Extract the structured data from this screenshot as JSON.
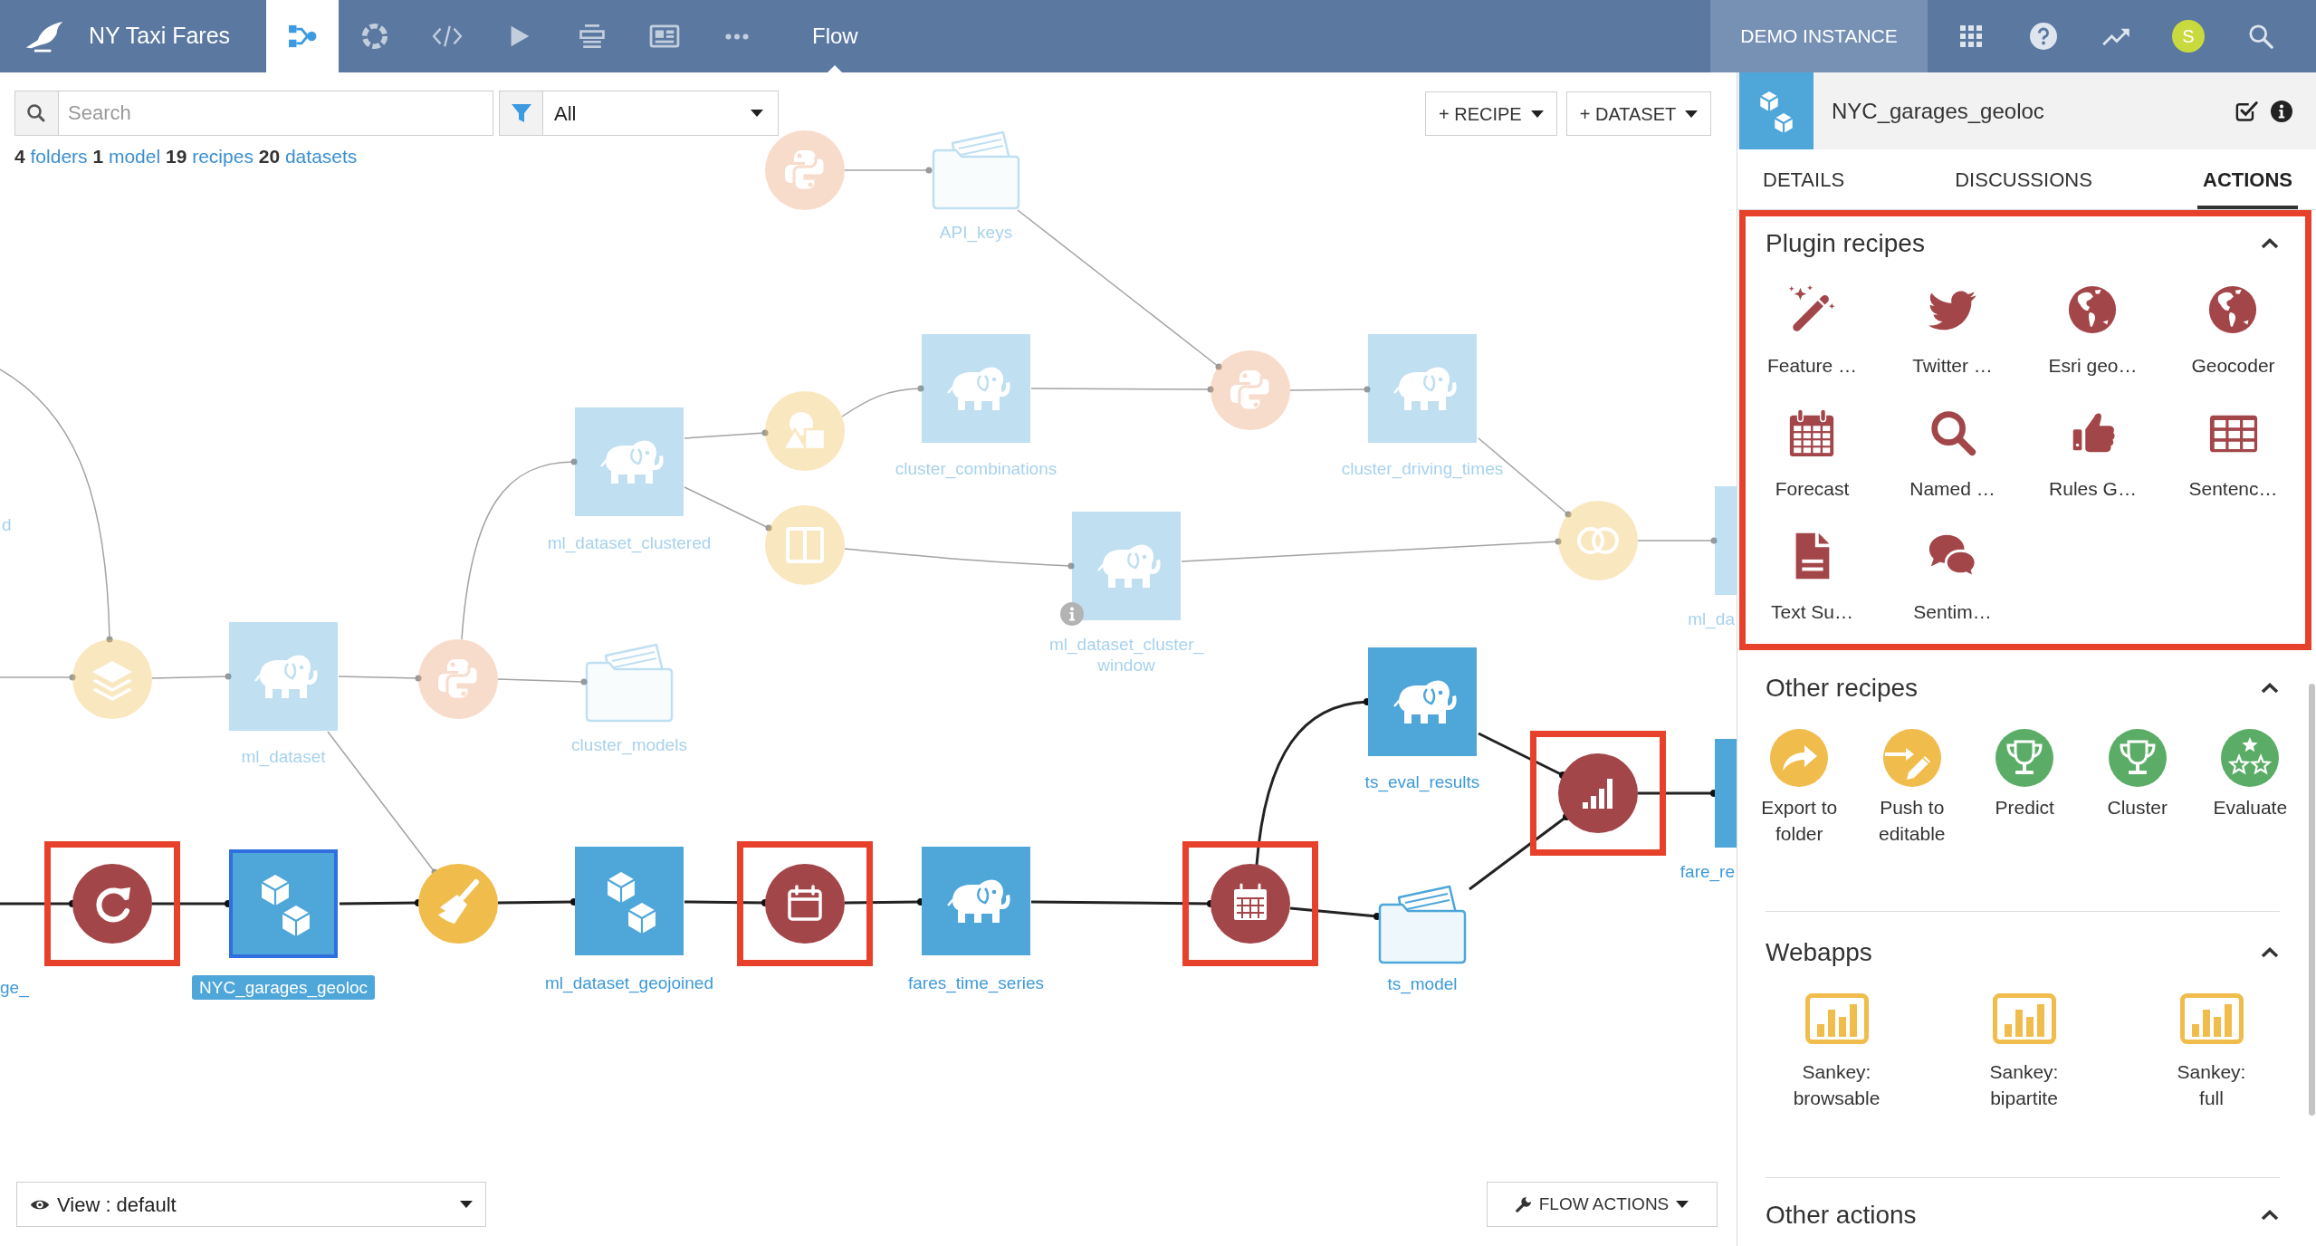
{
  "topbar": {
    "project_title": "NY Taxi Fares",
    "nav": [
      {
        "selected": true
      },
      {
        "selected": false
      },
      {
        "selected": false
      },
      {
        "selected": false
      },
      {
        "selected": false
      },
      {
        "selected": false
      },
      {
        "selected": false
      }
    ],
    "page_title": "Flow",
    "instance_label": "DEMO INSTANCE",
    "avatar": "S"
  },
  "toolbar": {
    "search": {
      "placeholder": "Search"
    },
    "filter": {
      "value": "All"
    },
    "counts": [
      {
        "count": "4",
        "label": "folders"
      },
      {
        "count": "1",
        "label": "model"
      },
      {
        "count": "19",
        "label": "recipes"
      },
      {
        "count": "20",
        "label": "datasets"
      }
    ],
    "buttons": [
      "+ RECIPE",
      "+ DATASET"
    ]
  },
  "flow": {
    "nodes": [
      {
        "kind": "recipe",
        "dimmed": true,
        "selected": false,
        "highlighted": false,
        "info_badge": false
      },
      {
        "kind": "folder",
        "label": "API_keys",
        "dimmed": true,
        "selected": false,
        "highlighted": false,
        "info_badge": false
      },
      {
        "kind": "recipe",
        "dimmed": true,
        "selected": false,
        "highlighted": false,
        "info_badge": false
      },
      {
        "kind": "dataset",
        "label": "cluster_combinations",
        "dimmed": true,
        "selected": false,
        "highlighted": false,
        "info_badge": false
      },
      {
        "kind": "dataset",
        "label": "cluster_driving_times",
        "dimmed": true,
        "selected": false,
        "highlighted": false,
        "info_badge": false
      },
      {
        "kind": "recipe",
        "dimmed": true,
        "selected": false,
        "highlighted": false,
        "info_badge": false
      },
      {
        "kind": "dataset",
        "label": "ml_dataset_clustered",
        "dimmed": true,
        "selected": false,
        "highlighted": false,
        "info_badge": false
      },
      {
        "kind": "recipe",
        "dimmed": true,
        "selected": false,
        "highlighted": false,
        "info_badge": false
      },
      {
        "kind": "dataset",
        "label": "ml_dataset_cluster_window",
        "dimmed": true,
        "selected": false,
        "highlighted": false,
        "info_badge": true
      },
      {
        "kind": "recipe",
        "dimmed": true,
        "selected": false,
        "highlighted": false,
        "info_badge": false
      },
      {
        "kind": "dataset",
        "label": "ml_da",
        "dimmed": true,
        "selected": false,
        "highlighted": false,
        "info_badge": false
      },
      {
        "kind": "dataset",
        "label": "d",
        "dimmed": true,
        "selected": false,
        "highlighted": false,
        "info_badge": false
      },
      {
        "kind": "recipe",
        "dimmed": true,
        "selected": false,
        "highlighted": false,
        "info_badge": false
      },
      {
        "kind": "dataset",
        "label": "ml_dataset",
        "dimmed": true,
        "selected": false,
        "highlighted": false,
        "info_badge": false
      },
      {
        "kind": "recipe",
        "dimmed": true,
        "selected": false,
        "highlighted": false,
        "info_badge": false
      },
      {
        "kind": "folder",
        "label": "cluster_models",
        "dimmed": true,
        "selected": false,
        "highlighted": false,
        "info_badge": false
      },
      {
        "kind": "dataset",
        "label": "ge_",
        "dimmed": false,
        "selected": false,
        "highlighted": false,
        "info_badge": false
      },
      {
        "kind": "recipe",
        "dimmed": false,
        "selected": false,
        "highlighted": true,
        "info_badge": false
      },
      {
        "kind": "dataset",
        "label": "NYC_garages_geoloc",
        "dimmed": false,
        "selected": true,
        "highlighted": false,
        "info_badge": false
      },
      {
        "kind": "recipe",
        "dimmed": false,
        "selected": false,
        "highlighted": false,
        "info_badge": false
      },
      {
        "kind": "dataset",
        "label": "ml_dataset_geojoined",
        "dimmed": false,
        "selected": false,
        "highlighted": false,
        "info_badge": false
      },
      {
        "kind": "recipe",
        "dimmed": false,
        "selected": false,
        "highlighted": true,
        "info_badge": false
      },
      {
        "kind": "dataset",
        "label": "fares_time_series",
        "dimmed": false,
        "selected": false,
        "highlighted": false,
        "info_badge": false
      },
      {
        "kind": "recipe",
        "dimmed": false,
        "selected": false,
        "highlighted": true,
        "info_badge": false
      },
      {
        "kind": "dataset",
        "label": "ts_eval_results",
        "dimmed": false,
        "selected": false,
        "highlighted": false,
        "info_badge": false
      },
      {
        "kind": "folder",
        "label": "ts_model",
        "dimmed": false,
        "selected": false,
        "highlighted": false,
        "info_badge": false
      },
      {
        "kind": "recipe",
        "dimmed": false,
        "selected": false,
        "highlighted": true,
        "info_badge": false
      },
      {
        "kind": "dataset",
        "label": "fare_re",
        "dimmed": false,
        "selected": false,
        "highlighted": false,
        "info_badge": false
      }
    ]
  },
  "bottom_bar": {
    "view": "View : default",
    "flow_actions": "FLOW ACTIONS"
  },
  "panel": {
    "title": "NYC_garages_geoloc",
    "tabs": [
      {
        "label": "DETAILS",
        "selected": false
      },
      {
        "label": "DISCUSSIONS",
        "selected": false
      },
      {
        "label": "ACTIONS",
        "selected": true
      }
    ],
    "sections": [
      {
        "title": "Plugin recipes",
        "expanded": true,
        "highlighted": true,
        "items": [
          "Feature …",
          "Twitter …",
          "Esri geo…",
          "Geocoder",
          "Forecast",
          "Named …",
          "Rules G…",
          "Sentenc…",
          "Text Su…",
          "Sentim…"
        ]
      },
      {
        "title": "Other recipes",
        "expanded": true,
        "highlighted": false,
        "items": [
          "Export to folder",
          "Push to editable",
          "Predict",
          "Cluster",
          "Evaluate"
        ]
      },
      {
        "title": "Webapps",
        "expanded": true,
        "highlighted": false,
        "items": [
          "Sankey: browsable",
          "Sankey: bipartite",
          "Sankey: full"
        ]
      },
      {
        "title": "Other actions",
        "expanded": true,
        "highlighted": false
      }
    ]
  }
}
